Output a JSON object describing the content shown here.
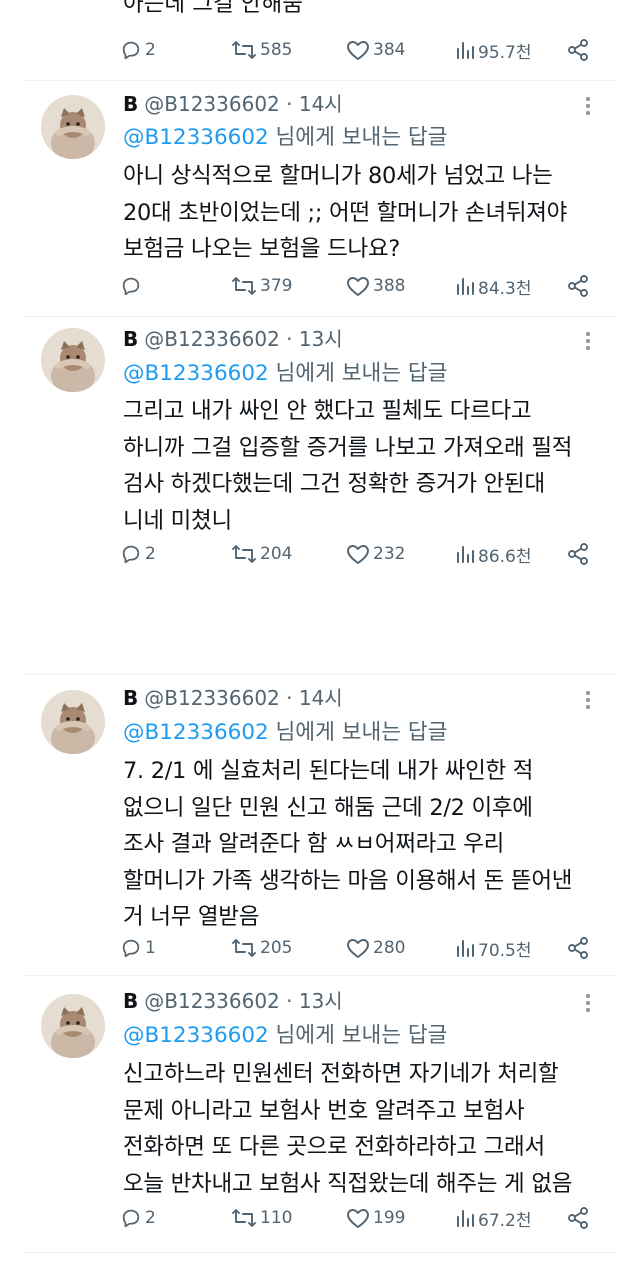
{
  "top": {
    "text": "아는데 그걸 안해줌",
    "actions": {
      "replies": "2",
      "retweets": "585",
      "likes": "384",
      "views": "95.7천"
    }
  },
  "tweets": [
    {
      "name": "B",
      "handle": "@B12336602",
      "time": "14시",
      "reply_handle": "@B12336602",
      "reply_suffix": " 님에게 보내는 답글",
      "text": "아니 상식적으로 할머니가 80세가 넘었고 나는\n20대 초반이었는데 ;; 어떤 할머니가 손녀뒤져야\n보험금 나오는 보험을 드나요?",
      "actions": {
        "replies": "",
        "retweets": "379",
        "likes": "388",
        "views": "84.3천"
      }
    },
    {
      "name": "B",
      "handle": "@B12336602",
      "time": "13시",
      "reply_handle": "@B12336602",
      "reply_suffix": " 님에게 보내는 답글",
      "text": "그리고 내가 싸인 안 했다고 필체도 다르다고\n하니까 그걸 입증할 증거를 나보고 가져오래 필적\n검사 하겠다했는데 그건 정확한 증거가 안된대\n니네 미쳤니",
      "actions": {
        "replies": "2",
        "retweets": "204",
        "likes": "232",
        "views": "86.6천"
      }
    },
    {
      "name": "B",
      "handle": "@B12336602",
      "time": "14시",
      "reply_handle": "@B12336602",
      "reply_suffix": " 님에게 보내는 답글",
      "text": "7. 2/1 에 실효처리 된다는데 내가 싸인한 적\n없으니 일단 민원 신고 해둠 근데 2/2 이후에\n조사 결과 알려준다 함 ㅆㅂ어쩌라고 우리\n할머니가 가족 생각하는 마음 이용해서 돈 뜯어낸\n거 너무 열받음",
      "actions": {
        "replies": "1",
        "retweets": "205",
        "likes": "280",
        "views": "70.5천"
      }
    },
    {
      "name": "B",
      "handle": "@B12336602",
      "time": "13시",
      "reply_handle": "@B12336602",
      "reply_suffix": " 님에게 보내는 답글",
      "text": "신고하느라 민원센터 전화하면 자기네가 처리할\n문제 아니라고 보험사 번호 알려주고 보험사\n전화하면 또 다른 곳으로 전화하라하고 그래서\n오늘 반차내고 보험사 직접왔는데 해주는 게 없음",
      "actions": {
        "replies": "2",
        "retweets": "110",
        "likes": "199",
        "views": "67.2천"
      }
    }
  ]
}
